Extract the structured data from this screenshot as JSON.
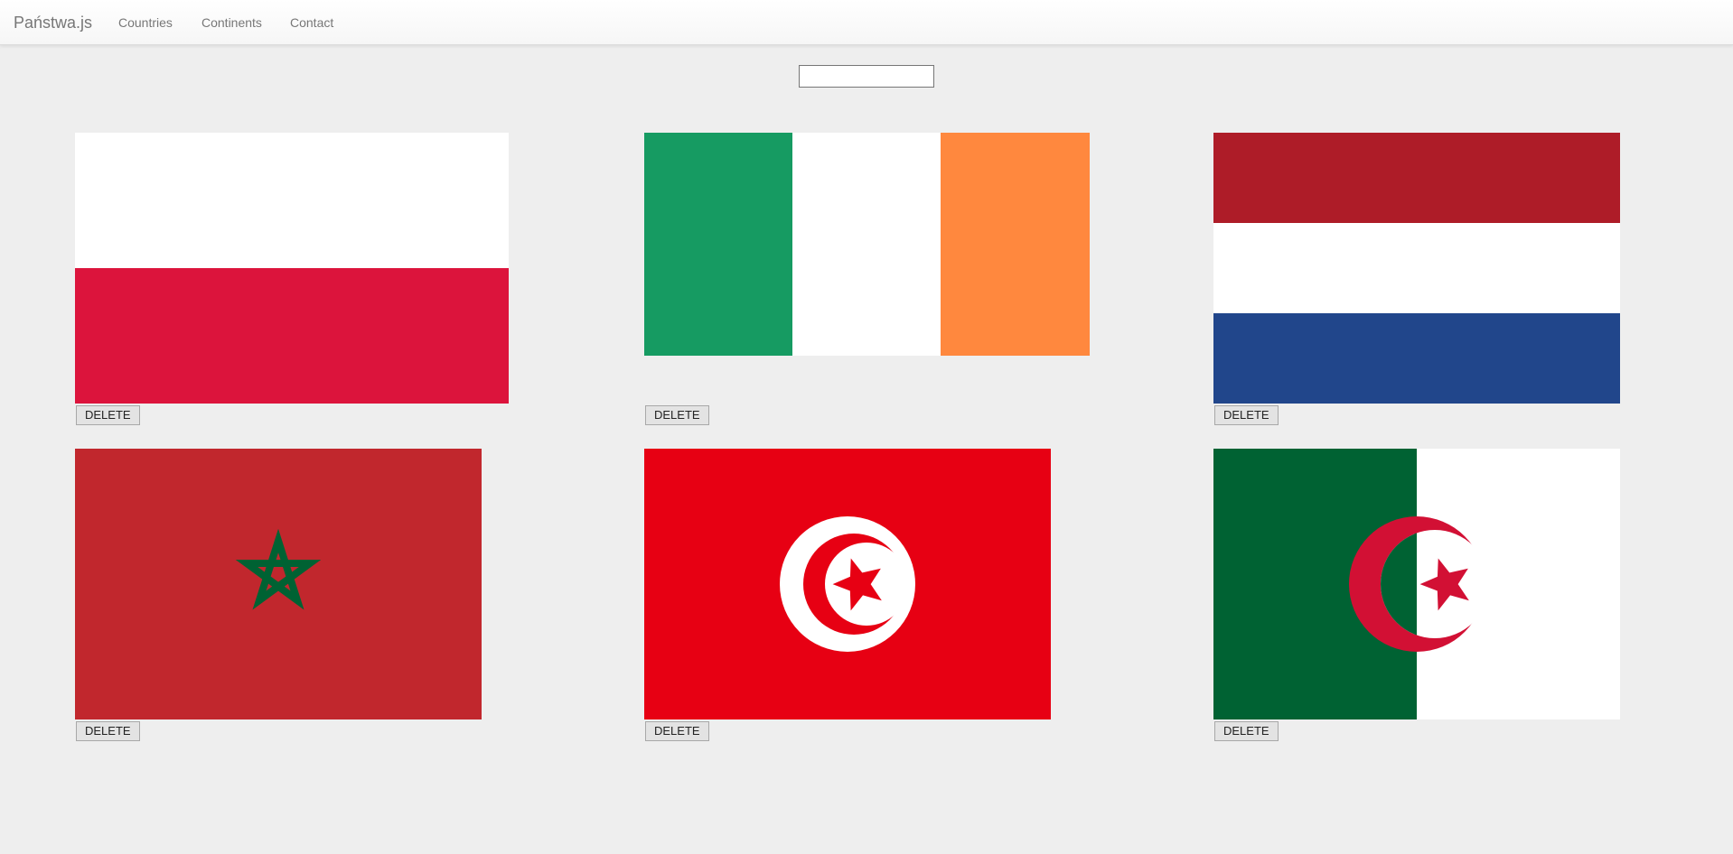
{
  "navbar": {
    "brand": "Państwa.js",
    "links": [
      "Countries",
      "Continents",
      "Contact"
    ]
  },
  "search": {
    "value": "",
    "placeholder": ""
  },
  "countries": [
    {
      "flag": "poland-flag",
      "delete_label": "DELETE",
      "colors": [
        "#ffffff",
        "#dc143c"
      ]
    },
    {
      "flag": "ireland-flag",
      "delete_label": "DELETE",
      "colors": [
        "#169b62",
        "#ffffff",
        "#ff883e"
      ]
    },
    {
      "flag": "netherlands-flag",
      "delete_label": "DELETE",
      "colors": [
        "#ae1c28",
        "#ffffff",
        "#21468b"
      ]
    },
    {
      "flag": "morocco-flag",
      "delete_label": "DELETE",
      "colors": [
        "#c1272d",
        "#006233"
      ]
    },
    {
      "flag": "tunisia-flag",
      "delete_label": "DELETE",
      "colors": [
        "#e70013",
        "#ffffff"
      ]
    },
    {
      "flag": "algeria-flag",
      "delete_label": "DELETE",
      "colors": [
        "#006233",
        "#ffffff",
        "#d21034"
      ]
    }
  ]
}
